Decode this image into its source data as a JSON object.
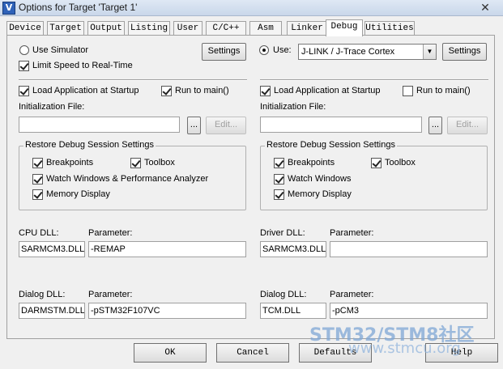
{
  "window": {
    "title": "Options for Target 'Target 1'",
    "app_icon_text": "V",
    "close_symbol": "✕"
  },
  "tabs": [
    {
      "label": "Device"
    },
    {
      "label": "Target"
    },
    {
      "label": "Output"
    },
    {
      "label": "Listing"
    },
    {
      "label": "User"
    },
    {
      "label": "C/C++"
    },
    {
      "label": "Asm"
    },
    {
      "label": "Linker"
    },
    {
      "label": "Debug",
      "active": true
    },
    {
      "label": "Utilities"
    }
  ],
  "left": {
    "use_simulator_label": "Use Simulator",
    "use_simulator_selected": false,
    "limit_speed_label": "Limit Speed to Real-Time",
    "limit_speed_checked": true,
    "settings_label": "Settings",
    "load_app_label": "Load Application at Startup",
    "load_app_checked": true,
    "run_to_main_label": "Run to main()",
    "run_to_main_checked": true,
    "init_file_label": "Initialization File:",
    "init_file_value": "",
    "browse_label": "...",
    "edit_label": "Edit...",
    "restore_group_title": "Restore Debug Session Settings",
    "breakpoints_label": "Breakpoints",
    "toolbox_label": "Toolbox",
    "watch_label": "Watch Windows & Performance Analyzer",
    "memory_label": "Memory Display",
    "cpu_dll_label": "CPU DLL:",
    "cpu_dll_value": "SARMCM3.DLL",
    "cpu_param_label": "Parameter:",
    "cpu_param_value": "-REMAP",
    "dialog_dll_label": "Dialog DLL:",
    "dialog_dll_value": "DARMSTM.DLL",
    "dialog_param_label": "Parameter:",
    "dialog_param_value": "-pSTM32F107VC"
  },
  "right": {
    "use_label": "Use:",
    "use_selected": true,
    "driver_select_value": "J-LINK / J-Trace Cortex",
    "settings_label": "Settings",
    "load_app_label": "Load Application at Startup",
    "load_app_checked": true,
    "run_to_main_label": "Run to main()",
    "run_to_main_checked": false,
    "init_file_label": "Initialization File:",
    "init_file_value": "",
    "browse_label": "...",
    "edit_label": "Edit...",
    "restore_group_title": "Restore Debug Session Settings",
    "breakpoints_label": "Breakpoints",
    "toolbox_label": "Toolbox",
    "watch_label": "Watch Windows",
    "memory_label": "Memory Display",
    "driver_dll_label": "Driver DLL:",
    "driver_dll_value": "SARMCM3.DLL",
    "driver_param_label": "Parameter:",
    "driver_param_value": "",
    "dialog_dll_label": "Dialog DLL:",
    "dialog_dll_value": "TCM.DLL",
    "dialog_param_label": "Parameter:",
    "dialog_param_value": "-pCM3"
  },
  "buttons": {
    "ok": "OK",
    "cancel": "Cancel",
    "defaults": "Defaults",
    "help": "Help"
  },
  "watermark": {
    "line1": "STM32/STM8社区",
    "line2": "www.stmcu.org"
  }
}
